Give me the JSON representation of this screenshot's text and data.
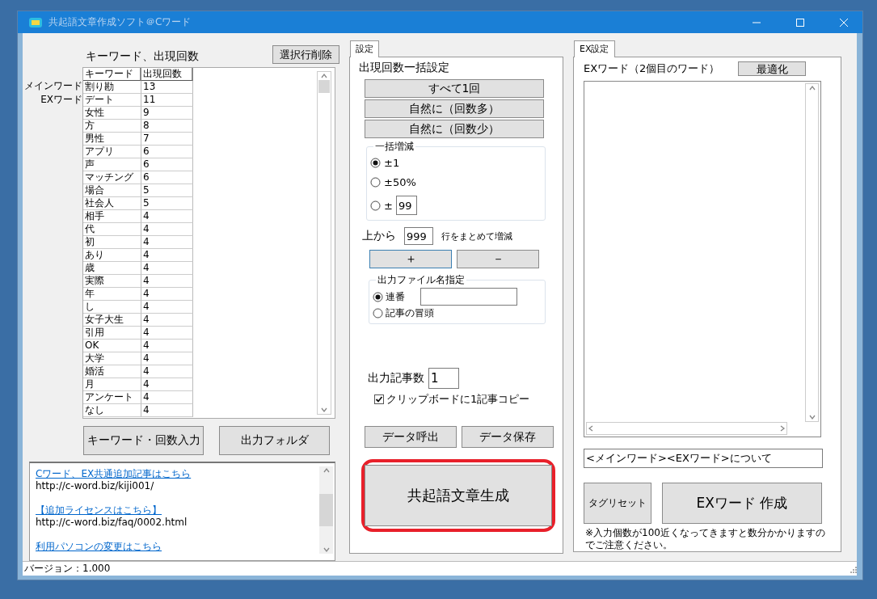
{
  "window": {
    "title": "共起語文章作成ソフト＠Cワード"
  },
  "keywords": {
    "heading": "キーワード、出現回数",
    "delete_button": "選択行削除",
    "row_labels": [
      "メインワード",
      "EXワード"
    ],
    "columns": [
      "キーワード",
      "出現回数"
    ],
    "rows": [
      [
        "割り勘",
        "13"
      ],
      [
        "デート",
        "11"
      ],
      [
        "女性",
        "9"
      ],
      [
        "方",
        "8"
      ],
      [
        "男性",
        "7"
      ],
      [
        "アプリ",
        "6"
      ],
      [
        "声",
        "6"
      ],
      [
        "マッチング",
        "6"
      ],
      [
        "場合",
        "5"
      ],
      [
        "社会人",
        "5"
      ],
      [
        "相手",
        "4"
      ],
      [
        "代",
        "4"
      ],
      [
        "初",
        "4"
      ],
      [
        "あり",
        "4"
      ],
      [
        "歳",
        "4"
      ],
      [
        "実際",
        "4"
      ],
      [
        "年",
        "4"
      ],
      [
        "し",
        "4"
      ],
      [
        "女子大生",
        "4"
      ],
      [
        "引用",
        "4"
      ],
      [
        "OK",
        "4"
      ],
      [
        "大学",
        "4"
      ],
      [
        "婚活",
        "4"
      ],
      [
        "月",
        "4"
      ],
      [
        "アンケート",
        "4"
      ],
      [
        "なし",
        "4"
      ]
    ],
    "buttons": [
      "キーワード・回数入力",
      "出力フォルダ"
    ],
    "links": [
      {
        "kind": "link",
        "text": "Cワード、EX共通追加記事はこちら"
      },
      {
        "kind": "url",
        "text": "http://c-word.biz/kiji001/"
      },
      {
        "kind": "link",
        "text": "【追加ライセンスはこちら】"
      },
      {
        "kind": "url",
        "text": "http://c-word.biz/faq/0002.html"
      },
      {
        "kind": "link",
        "text": "利用パソコンの変更はこちら"
      }
    ]
  },
  "settings": {
    "tab": {
      "label": "設定",
      "selected": true
    },
    "heading": "出現回数一括設定",
    "preset_buttons": [
      "すべて1回",
      "自然に（回数多）",
      "自然に（回数少）"
    ],
    "bulk": {
      "title": "一括増減",
      "options": [
        {
          "label": "±1",
          "selected": true
        },
        {
          "label": "±50%",
          "selected": false
        },
        {
          "label": "±",
          "selected": false,
          "value": "99"
        }
      ]
    },
    "from_top": {
      "label": "上から",
      "value": "999",
      "suffix": "行をまとめて増減"
    },
    "step_buttons": [
      {
        "label": "＋",
        "focused": true
      },
      {
        "label": "－",
        "focused": false
      }
    ],
    "filename": {
      "title": "出力ファイル名指定",
      "options": [
        {
          "label": "連番",
          "selected": true,
          "kind": "field"
        },
        {
          "label": "記事の冒頭",
          "selected": false,
          "kind": "plain"
        }
      ]
    },
    "count": {
      "label": "出力記事数",
      "value": "1"
    },
    "clipboard": {
      "label": "クリップボードに1記事コピー",
      "checked": true
    },
    "data_buttons": [
      "データ呼出",
      "データ保存"
    ],
    "generate": {
      "label": "共起語文章生成",
      "highlighted": true
    }
  },
  "ex": {
    "tab": {
      "label": "EX設定",
      "selected": true
    },
    "heading": "EXワード（2個目のワード）",
    "optimize_button": "最適化",
    "template": "<メインワード><EXワード>について",
    "reset_button": "タグリセット",
    "create_button": "EXワード 作成",
    "note": "※入力個数が100近くなってきますと数分かかりますのでご注意ください。"
  },
  "status_bar": {
    "text": "バージョン：1.000"
  }
}
